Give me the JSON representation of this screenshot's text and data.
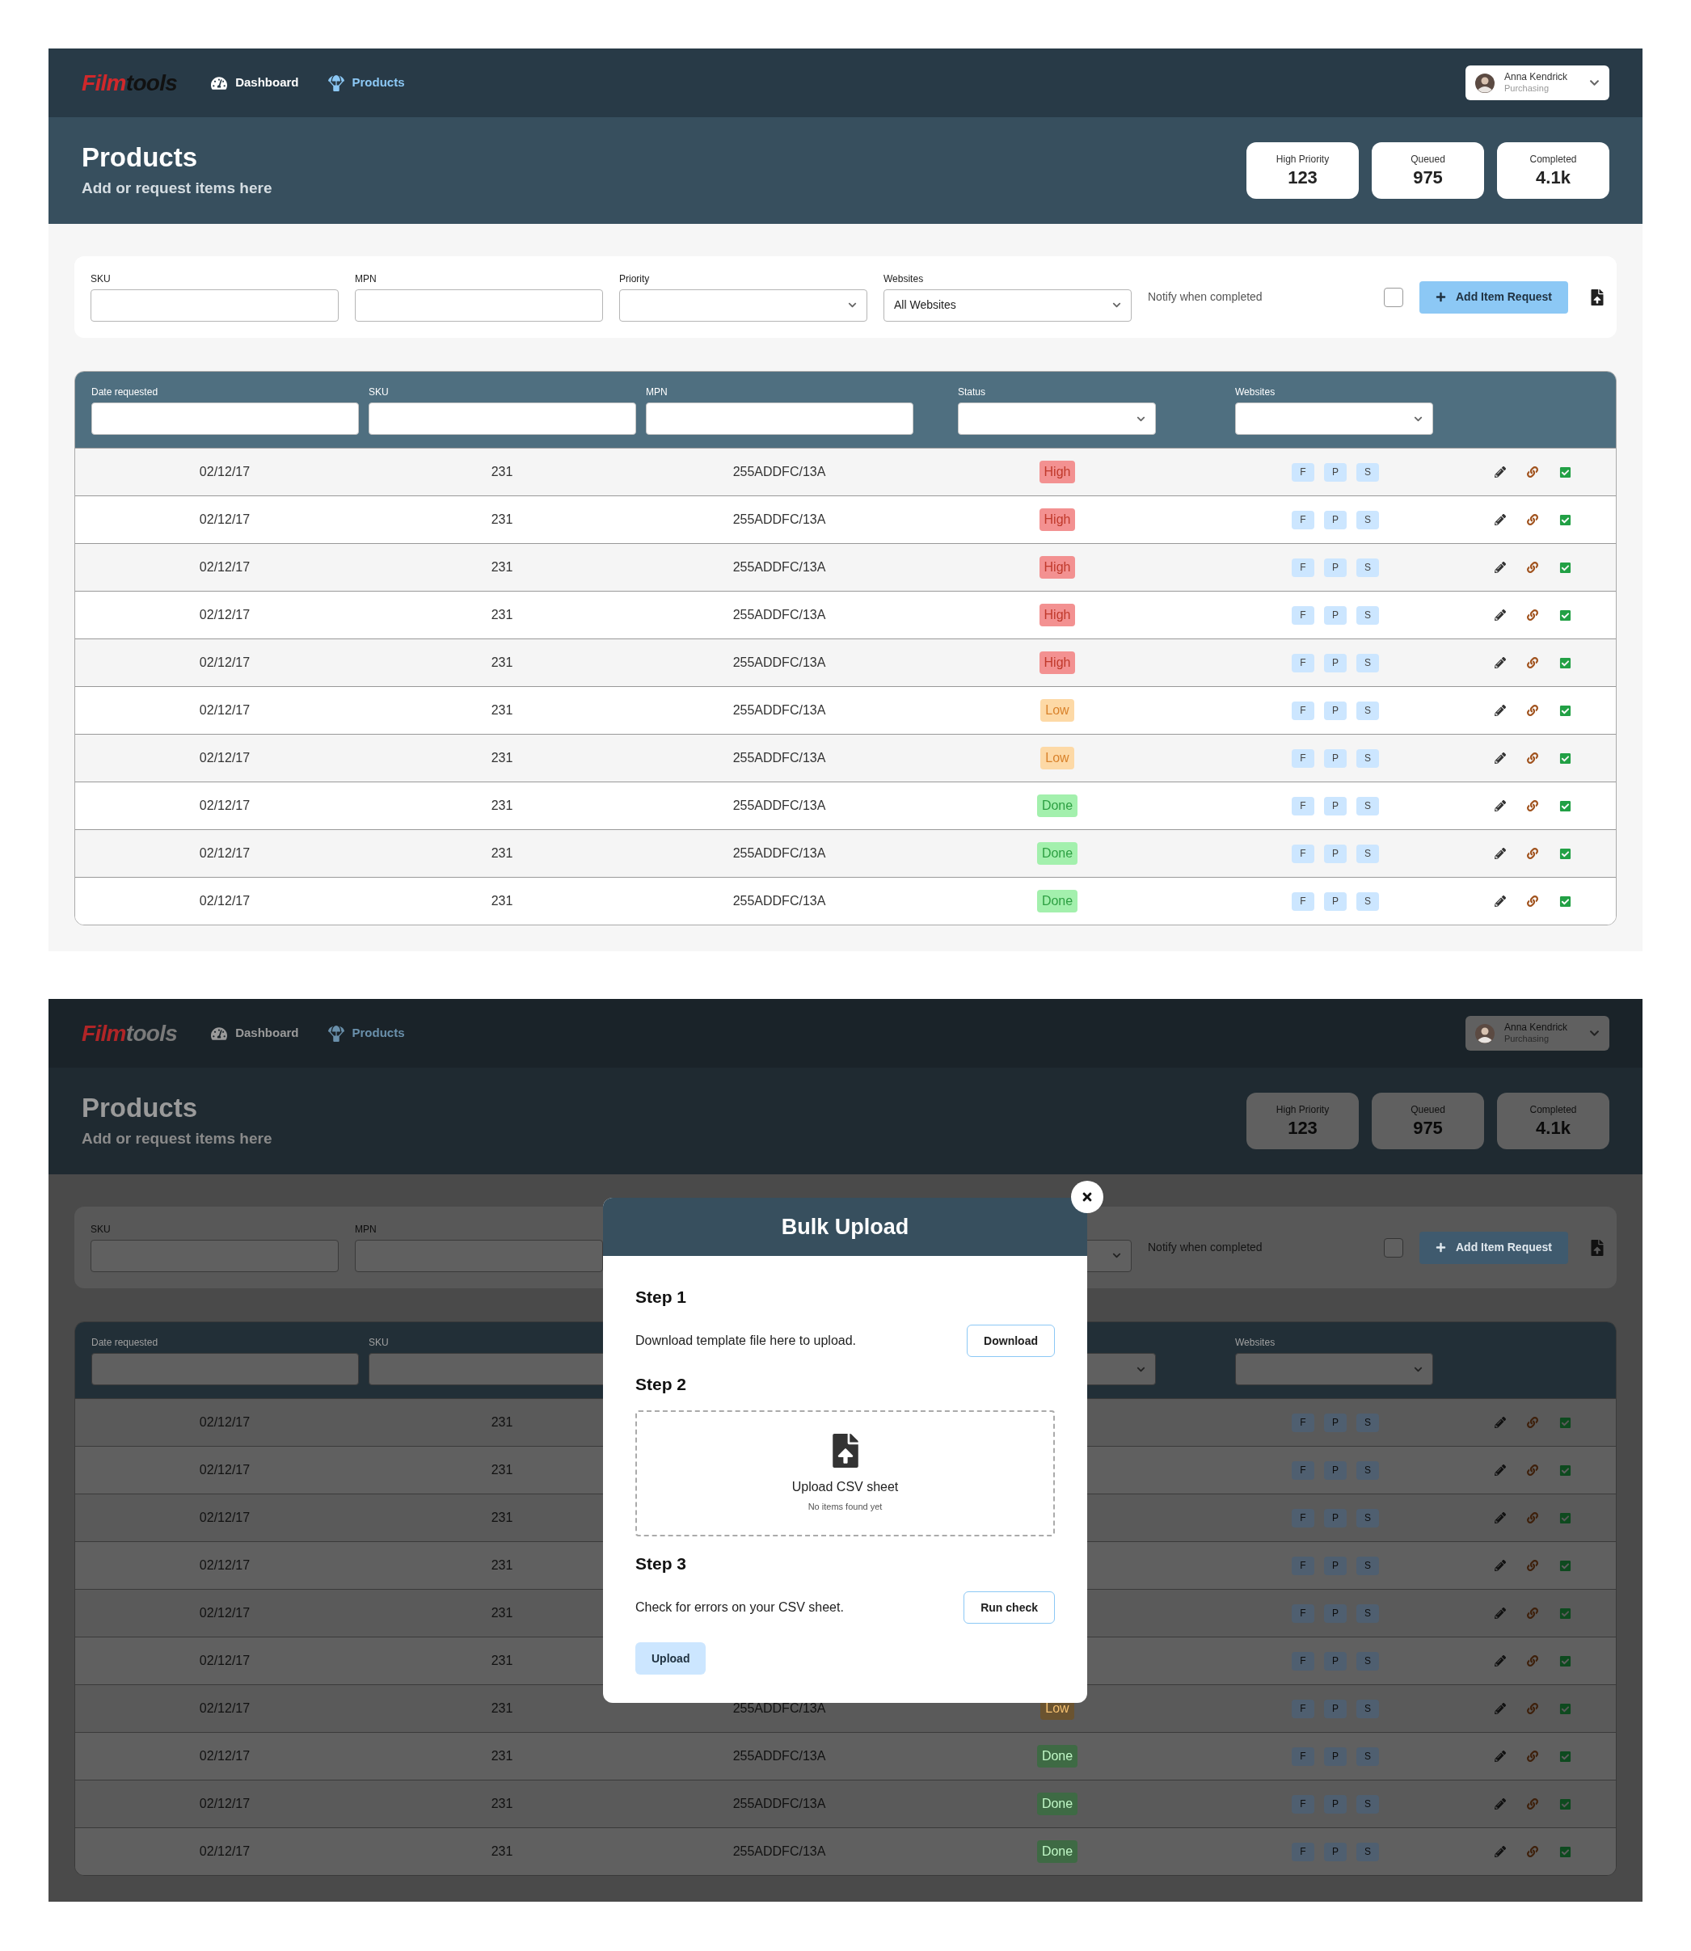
{
  "screens": [
    {
      "dimmed": false,
      "nav": {
        "logo": [
          {
            "text": "Film",
            "color": "#d0282b"
          },
          {
            "text": "tools",
            "color": "#111111"
          }
        ],
        "items": [
          {
            "label": "Dashboard",
            "selected": false,
            "kind": "gauge"
          },
          {
            "label": "Products",
            "selected": true,
            "kind": "parachute"
          }
        ],
        "user": {
          "name": "Anna Kendrick",
          "role": "Purchasing"
        }
      },
      "header": {
        "title": "Products",
        "subtitle": "Add or request items here",
        "stats": [
          {
            "label": "High Priority",
            "value": "123"
          },
          {
            "label": "Queued",
            "value": "975"
          },
          {
            "label": "Completed",
            "value": "4.1k"
          }
        ]
      },
      "filters": {
        "fields": [
          {
            "kind": "text",
            "label": "SKU"
          },
          {
            "kind": "text",
            "label": "MPN"
          },
          {
            "kind": "select",
            "label": "Priority"
          },
          {
            "kind": "select",
            "label": "Websites",
            "value": "All Websites"
          }
        ],
        "notify": {
          "label": "Notify when completed",
          "checked": false
        },
        "button": "Add Item Request"
      },
      "table": {
        "filters": [
          {
            "kind": "text",
            "label": "Date requested"
          },
          {
            "kind": "text",
            "label": "SKU"
          },
          {
            "kind": "text",
            "label": "MPN"
          },
          {
            "kind": "select",
            "label": "Status"
          },
          {
            "kind": "select",
            "label": "Websites"
          }
        ],
        "rows": [
          {
            "date": "02/12/17",
            "sku": "231",
            "mpn": "255ADDFC/13A",
            "status": {
              "label": "High",
              "kind": "high"
            },
            "sites": [
              "F",
              "P",
              "S"
            ]
          },
          {
            "date": "02/12/17",
            "sku": "231",
            "mpn": "255ADDFC/13A",
            "status": {
              "label": "High",
              "kind": "high"
            },
            "sites": [
              "F",
              "P",
              "S"
            ]
          },
          {
            "date": "02/12/17",
            "sku": "231",
            "mpn": "255ADDFC/13A",
            "status": {
              "label": "High",
              "kind": "high"
            },
            "sites": [
              "F",
              "P",
              "S"
            ]
          },
          {
            "date": "02/12/17",
            "sku": "231",
            "mpn": "255ADDFC/13A",
            "status": {
              "label": "High",
              "kind": "high"
            },
            "sites": [
              "F",
              "P",
              "S"
            ]
          },
          {
            "date": "02/12/17",
            "sku": "231",
            "mpn": "255ADDFC/13A",
            "status": {
              "label": "High",
              "kind": "high"
            },
            "sites": [
              "F",
              "P",
              "S"
            ]
          },
          {
            "date": "02/12/17",
            "sku": "231",
            "mpn": "255ADDFC/13A",
            "status": {
              "label": "Low",
              "kind": "low"
            },
            "sites": [
              "F",
              "P",
              "S"
            ]
          },
          {
            "date": "02/12/17",
            "sku": "231",
            "mpn": "255ADDFC/13A",
            "status": {
              "label": "Low",
              "kind": "low"
            },
            "sites": [
              "F",
              "P",
              "S"
            ]
          },
          {
            "date": "02/12/17",
            "sku": "231",
            "mpn": "255ADDFC/13A",
            "status": {
              "label": "Done",
              "kind": "done"
            },
            "sites": [
              "F",
              "P",
              "S"
            ]
          },
          {
            "date": "02/12/17",
            "sku": "231",
            "mpn": "255ADDFC/13A",
            "status": {
              "label": "Done",
              "kind": "done"
            },
            "sites": [
              "F",
              "P",
              "S"
            ]
          },
          {
            "date": "02/12/17",
            "sku": "231",
            "mpn": "255ADDFC/13A",
            "status": {
              "label": "Done",
              "kind": "done"
            },
            "sites": [
              "F",
              "P",
              "S"
            ]
          }
        ]
      }
    },
    {
      "dimmed": true,
      "nav": {
        "logo": [
          {
            "text": "Film",
            "color": "#b02527"
          },
          {
            "text": "tools",
            "color": "#7a7a7a"
          }
        ],
        "items": [
          {
            "label": "Dashboard",
            "selected": false,
            "kind": "gauge"
          },
          {
            "label": "Products",
            "selected": true,
            "kind": "parachute"
          }
        ],
        "user": {
          "name": "Anna Kendrick",
          "role": "Purchasing"
        }
      },
      "header": {
        "title": "Products",
        "subtitle": "Add or request items here",
        "stats": [
          {
            "label": "High Priority",
            "value": "123"
          },
          {
            "label": "Queued",
            "value": "975"
          },
          {
            "label": "Completed",
            "value": "4.1k"
          }
        ]
      },
      "filters": {
        "fields": [
          {
            "kind": "text",
            "label": "SKU"
          },
          {
            "kind": "text",
            "label": "MPN"
          },
          {
            "kind": "covered"
          },
          {
            "kind": "select"
          }
        ],
        "notify": {
          "label": "Notify when completed",
          "checked": false
        },
        "button": "Add Item Request"
      },
      "table": {
        "filters": [
          {
            "kind": "text",
            "label": "Date requested"
          },
          {
            "kind": "text",
            "label": "SKU"
          },
          {
            "kind": "covered"
          },
          {
            "kind": "select"
          },
          {
            "kind": "select",
            "label": "Websites"
          }
        ],
        "rows": [
          {
            "date": "02/12/17",
            "sku": "231",
            "sites": [
              "F",
              "P",
              "S"
            ]
          },
          {
            "date": "02/12/17",
            "sku": "231",
            "sites": [
              "F",
              "P",
              "S"
            ]
          },
          {
            "date": "02/12/17",
            "sku": "231",
            "sites": [
              "F",
              "P",
              "S"
            ]
          },
          {
            "date": "02/12/17",
            "sku": "231",
            "sites": [
              "F",
              "P",
              "S"
            ]
          },
          {
            "date": "02/12/17",
            "sku": "231",
            "sites": [
              "F",
              "P",
              "S"
            ]
          },
          {
            "date": "02/12/17",
            "sku": "231",
            "sites": [
              "F",
              "P",
              "S"
            ]
          },
          {
            "date": "02/12/17",
            "sku": "231",
            "mpn": "255ADDFC/13A",
            "status": {
              "label": "Low",
              "kind": "low"
            },
            "sites": [
              "F",
              "P",
              "S"
            ]
          },
          {
            "date": "02/12/17",
            "sku": "231",
            "mpn": "255ADDFC/13A",
            "status": {
              "label": "Done",
              "kind": "done"
            },
            "sites": [
              "F",
              "P",
              "S"
            ]
          },
          {
            "date": "02/12/17",
            "sku": "231",
            "mpn": "255ADDFC/13A",
            "status": {
              "label": "Done",
              "kind": "done"
            },
            "sites": [
              "F",
              "P",
              "S"
            ]
          },
          {
            "date": "02/12/17",
            "sku": "231",
            "mpn": "255ADDFC/13A",
            "status": {
              "label": "Done",
              "kind": "done"
            },
            "sites": [
              "F",
              "P",
              "S"
            ]
          }
        ]
      },
      "modal": {
        "title": "Bulk Upload",
        "steps": [
          {
            "kind": "action",
            "title": "Step 1",
            "text": "Download template file here to upload.",
            "button": "Download"
          },
          {
            "kind": "dropzone",
            "title": "Step 2",
            "text": "Upload CSV sheet",
            "hint": "No items found yet"
          },
          {
            "kind": "action",
            "title": "Step 3",
            "text": "Check for errors on your CSV sheet.",
            "button": "Run check"
          }
        ],
        "button": "Upload"
      }
    }
  ]
}
